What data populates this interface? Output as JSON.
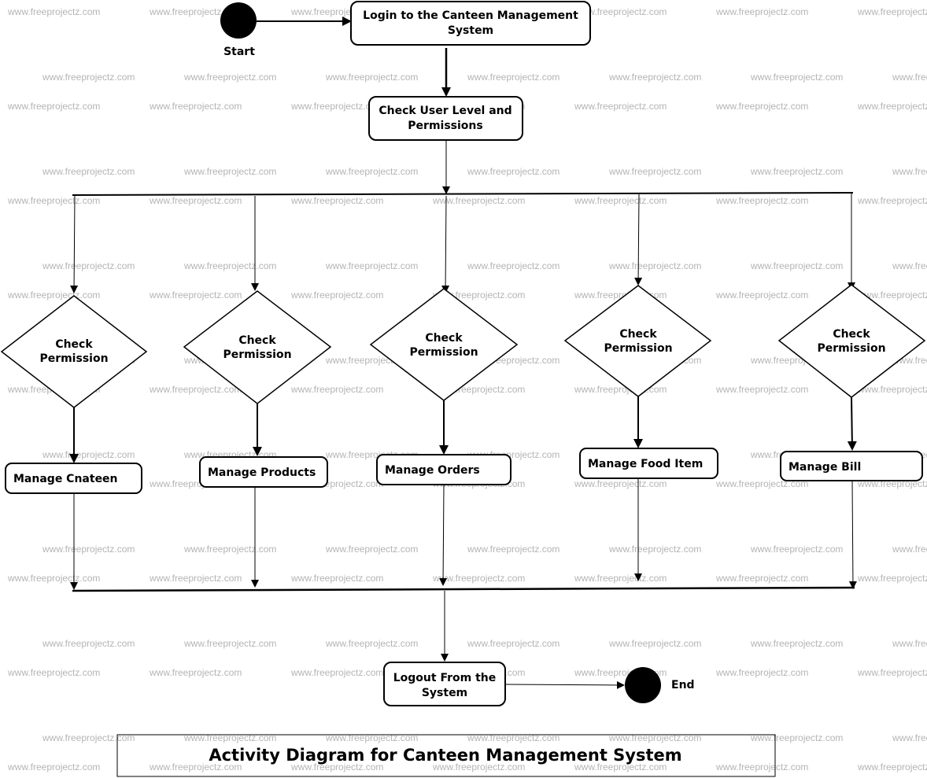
{
  "watermark": "www.freeprojectz.com",
  "title": "Activity Diagram for Canteen Management System",
  "start": {
    "label": "Start"
  },
  "end": {
    "label": "End"
  },
  "nodes": {
    "login": {
      "lines": [
        "Login to the Canteen Management",
        "System"
      ]
    },
    "check_user": {
      "lines": [
        "Check User Level and",
        "Permissions"
      ]
    },
    "logout": {
      "lines": [
        "Logout From the",
        "System"
      ]
    }
  },
  "branches": [
    {
      "decision": [
        "Check",
        "Permission"
      ],
      "activity": "Manage Cnateen"
    },
    {
      "decision": [
        "Check",
        "Permission"
      ],
      "activity": "Manage Products"
    },
    {
      "decision": [
        "Check",
        "Permission"
      ],
      "activity": "Manage Orders"
    },
    {
      "decision": [
        "Check",
        "Permission"
      ],
      "activity": "Manage Food Item"
    },
    {
      "decision": [
        "Check",
        "Permission"
      ],
      "activity": "Manage Bill"
    }
  ]
}
